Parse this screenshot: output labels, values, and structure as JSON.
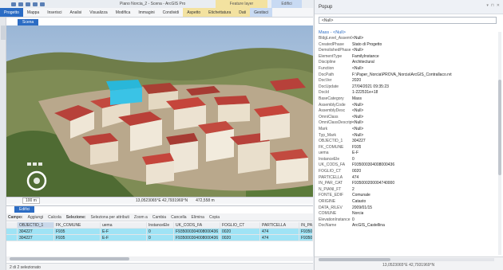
{
  "window": {
    "title": "Piano Norcia_2 - Scena - ArcGIS Pro",
    "context_tab_layer": "Feature layer",
    "context_tab_edifici": "Edifici"
  },
  "ribbon": {
    "tabs": [
      "Progetto",
      "Mappa",
      "Inserisci",
      "Analisi",
      "Visualizza",
      "Modifica",
      "Immagini",
      "Condividi",
      "Aspetto",
      "Etichettatura",
      "Dati",
      "Gestisci"
    ]
  },
  "map": {
    "tab_label": "Scena",
    "scale": "100 m",
    "coordinates": "13,0523065°E 42,7931969°N",
    "elevation": "472,558 m"
  },
  "table": {
    "tab_label": "Edifici",
    "toolbar": {
      "fields_label": "Campo:",
      "add": "Aggiungi",
      "calculate": "Calcola",
      "selection_label": "Selezione:",
      "select_by_attr": "Seleziona per attributi",
      "zoom": "Zoom a",
      "switch": "Cambia",
      "clear": "Cancella",
      "delete": "Elimina",
      "copy": "Copia"
    },
    "columns": [
      "",
      "OBJECTID_1",
      "FK_COMUNE",
      "uema",
      "InstanceEle",
      "UK_CODS_FA",
      "FOGLIO_CT",
      "PARTICELLA",
      "IN_PAR_CAT"
    ],
    "rows": [
      [
        "",
        "304227",
        "F935",
        "E-F",
        "0",
        "F935000304008000436",
        "0020",
        "474",
        "F935000300004"
      ],
      [
        "",
        "304227",
        "F935",
        "E-F",
        "0",
        "F935000304008000436",
        "0020",
        "474",
        "F935000300004"
      ]
    ],
    "status": "2 di 2 selezionato"
  },
  "popup": {
    "title": "Popup",
    "selector_value": "<Null>",
    "header": "Mass - <Null>",
    "attributes": [
      {
        "k": "BldgLevel_AssemOffset",
        "v": "<Null>"
      },
      {
        "k": "CreatedPhase",
        "v": "Stato di Progetto"
      },
      {
        "k": "DemolishedPhase",
        "v": "<Null>"
      },
      {
        "k": "ElementType",
        "v": "FamilyInstance"
      },
      {
        "k": "Discipline",
        "v": "Architectural"
      },
      {
        "k": "Function",
        "v": "<Null>"
      },
      {
        "k": "DocPath",
        "v": "F:\\Paper_Norcia\\PROVA_Norcia\\ArcGIS_Contrallaco.rvt"
      },
      {
        "k": "DocVer",
        "v": "2020"
      },
      {
        "k": "DocUpdate",
        "v": "27/04/2021 09:35:23"
      },
      {
        "k": "DocId",
        "v": "1-222531e+18"
      },
      {
        "k": "BaseCategory",
        "v": "Mass"
      },
      {
        "k": "AssemblyCode",
        "v": "<Null>"
      },
      {
        "k": "AssemblyDesc",
        "v": "<Null>"
      },
      {
        "k": "OmniClass",
        "v": "<Null>"
      },
      {
        "k": "OmniClassDescription",
        "v": "<Null>"
      },
      {
        "k": "Mark",
        "v": "<Null>"
      },
      {
        "k": "Typ_Mark",
        "v": "<Null>"
      },
      {
        "k": "OBJECTID_1",
        "v": "304227"
      },
      {
        "k": "FK_COMUNE",
        "v": "F935"
      },
      {
        "k": "uema",
        "v": "E-F"
      },
      {
        "k": "InstanceEle",
        "v": "0"
      },
      {
        "k": "UK_CODS_FA",
        "v": "F935000304008000436"
      },
      {
        "k": "FOGLIO_CT",
        "v": "0020"
      },
      {
        "k": "PARTICELLA",
        "v": "474"
      },
      {
        "k": "IN_PAR_CAT",
        "v": "F935000200004740000"
      },
      {
        "k": "N_PIANI_FT",
        "v": "2"
      },
      {
        "k": "FONTE_EDIF",
        "v": "Comunale"
      },
      {
        "k": "ORIGINE",
        "v": "Catasto"
      },
      {
        "k": "DATA_RILEV",
        "v": "2009/01/15"
      },
      {
        "k": "COMUNE",
        "v": "Norcia"
      },
      {
        "k": "ElevationInstance",
        "v": "0"
      },
      {
        "k": "DocName",
        "v": "ArcGIS_Castellina"
      }
    ],
    "footer_coords": "13,0523065°E 42,7931969°N"
  }
}
